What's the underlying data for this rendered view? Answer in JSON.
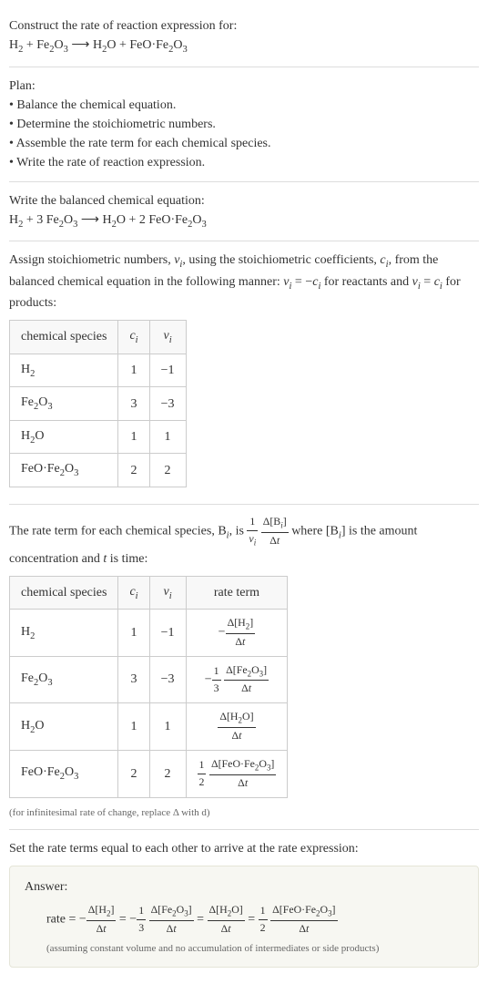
{
  "header": {
    "prompt": "Construct the rate of reaction expression for:",
    "equation_lhs1": "H",
    "equation_lhs1_sub": "2",
    "equation_plus1": " + Fe",
    "equation_lhs2_sub1": "2",
    "equation_lhs2_o": "O",
    "equation_lhs2_sub2": "3",
    "equation_arrow": " ⟶ H",
    "equation_rhs1_sub": "2",
    "equation_rhs1_o": "O + FeO·Fe",
    "equation_rhs2_sub1": "2",
    "equation_rhs2_o": "O",
    "equation_rhs2_sub2": "3"
  },
  "plan": {
    "title": "Plan:",
    "b1": "• Balance the chemical equation.",
    "b2": "• Determine the stoichiometric numbers.",
    "b3": "• Assemble the rate term for each chemical species.",
    "b4": "• Write the rate of reaction expression."
  },
  "balanced": {
    "intro": "Write the balanced chemical equation:",
    "eq_h2": "H",
    "eq_h2_sub": "2",
    "eq_plus3fe": " + 3 Fe",
    "eq_fe_sub1": "2",
    "eq_fe_o": "O",
    "eq_fe_sub2": "3",
    "eq_arrow": " ⟶ H",
    "eq_h2o_sub": "2",
    "eq_h2o_rest": "O + 2 FeO·Fe",
    "eq_feo_sub1": "2",
    "eq_feo_o": "O",
    "eq_feo_sub2": "3"
  },
  "stoich": {
    "intro1": "Assign stoichiometric numbers, ",
    "nu": "ν",
    "sub_i": "i",
    "intro2": ", using the stoichiometric coefficients, ",
    "c": "c",
    "intro3": ", from the balanced chemical equation in the following manner: ",
    "eq1": " = −",
    "intro4": " for reactants and ",
    "eq2": " = ",
    "intro5": " for products:",
    "th1": "chemical species",
    "th2_c": "c",
    "th2_i": "i",
    "th3_nu": "ν",
    "th3_i": "i",
    "r1_sp": "H",
    "r1_sub": "2",
    "r1_c": "1",
    "r1_nu": "−1",
    "r2_sp": "Fe",
    "r2_sub1": "2",
    "r2_o": "O",
    "r2_sub2": "3",
    "r2_c": "3",
    "r2_nu": "−3",
    "r3_sp": "H",
    "r3_sub": "2",
    "r3_o": "O",
    "r3_c": "1",
    "r3_nu": "1",
    "r4_sp": "FeO·Fe",
    "r4_sub1": "2",
    "r4_o": "O",
    "r4_sub2": "3",
    "r4_c": "2",
    "r4_nu": "2"
  },
  "rateterm": {
    "intro1": "The rate term for each chemical species, B",
    "sub_i": "i",
    "intro2": ", is ",
    "frac1_num": "1",
    "frac1_den_nu": "ν",
    "frac1_den_i": "i",
    "frac2_num_d": "Δ[B",
    "frac2_num_close": "]",
    "frac2_den": "Δt",
    "intro3": " where [B",
    "intro4": "] is the amount concentration and ",
    "t": "t",
    "intro5": " is time:",
    "th1": "chemical species",
    "th2_c": "c",
    "th2_i": "i",
    "th3_nu": "ν",
    "th3_i": "i",
    "th4": "rate term",
    "r1_sp": "H",
    "r1_sub": "2",
    "r1_c": "1",
    "r1_nu": "−1",
    "r1_rt_neg": "−",
    "r1_rt_num": "Δ[H",
    "r1_rt_num_sub": "2",
    "r1_rt_num_close": "]",
    "r1_rt_den": "Δt",
    "r2_sp": "Fe",
    "r2_sub1": "2",
    "r2_o": "O",
    "r2_sub2": "3",
    "r2_c": "3",
    "r2_nu": "−3",
    "r2_rt_neg": "−",
    "r2_rt_f1_num": "1",
    "r2_rt_f1_den": "3",
    "r2_rt_f2_num": "Δ[Fe",
    "r2_rt_f2_num_sub1": "2",
    "r2_rt_f2_num_o": "O",
    "r2_rt_f2_num_sub2": "3",
    "r2_rt_f2_num_close": "]",
    "r2_rt_f2_den": "Δt",
    "r3_sp": "H",
    "r3_sub": "2",
    "r3_o": "O",
    "r3_c": "1",
    "r3_nu": "1",
    "r3_rt_num": "Δ[H",
    "r3_rt_num_sub": "2",
    "r3_rt_num_o": "O]",
    "r3_rt_den": "Δt",
    "r4_sp": "FeO·Fe",
    "r4_sub1": "2",
    "r4_o": "O",
    "r4_sub2": "3",
    "r4_c": "2",
    "r4_nu": "2",
    "r4_rt_f1_num": "1",
    "r4_rt_f1_den": "2",
    "r4_rt_f2_num": "Δ[FeO·Fe",
    "r4_rt_f2_num_sub1": "2",
    "r4_rt_f2_num_o": "O",
    "r4_rt_f2_num_sub2": "3",
    "r4_rt_f2_num_close": "]",
    "r4_rt_f2_den": "Δt",
    "note": "(for infinitesimal rate of change, replace Δ with d)"
  },
  "final": {
    "intro": "Set the rate terms equal to each other to arrive at the rate expression:",
    "answer_label": "Answer:",
    "rate_label": "rate = −",
    "t1_num": "Δ[H",
    "t1_num_sub": "2",
    "t1_num_close": "]",
    "t1_den": "Δt",
    "eq1": " = −",
    "t2a_num": "1",
    "t2a_den": "3",
    "t2b_num": "Δ[Fe",
    "t2b_num_sub1": "2",
    "t2b_num_o": "O",
    "t2b_num_sub2": "3",
    "t2b_num_close": "]",
    "t2b_den": "Δt",
    "eq2": " = ",
    "t3_num": "Δ[H",
    "t3_num_sub": "2",
    "t3_num_o": "O]",
    "t3_den": "Δt",
    "eq3": " = ",
    "t4a_num": "1",
    "t4a_den": "2",
    "t4b_num": "Δ[FeO·Fe",
    "t4b_num_sub1": "2",
    "t4b_num_o": "O",
    "t4b_num_sub2": "3",
    "t4b_num_close": "]",
    "t4b_den": "Δt",
    "assume": "(assuming constant volume and no accumulation of intermediates or side products)"
  }
}
